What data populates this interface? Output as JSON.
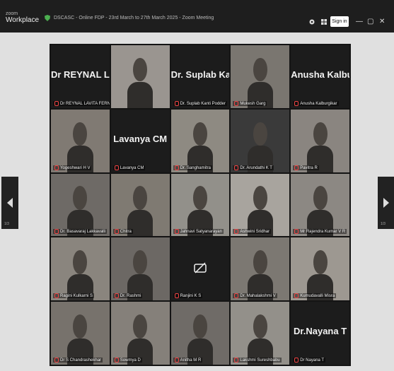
{
  "app": {
    "brand_top": "zoom",
    "brand_bottom": "Workplace"
  },
  "meeting_title": "DSCASC - Online FDP - 23rd March to 27th March 2025 - Zoom Meeting",
  "signin_label": "Sign in",
  "window_controls": {
    "minimize": "—",
    "maximize": "▢",
    "close": "✕"
  },
  "page_indicator": "1/3",
  "participants": [
    {
      "name": "Dr REYNAL LAV...",
      "label": "Dr REYNAL LAVITA FERNAN...",
      "type": "name"
    },
    {
      "label": "",
      "type": "video",
      "tone": "#9a9590"
    },
    {
      "name": "Dr. Suplab Kant...",
      "label": "Dr. Suplab Kanti Podder",
      "type": "name"
    },
    {
      "label": "Mukesh Garg",
      "type": "video",
      "tone": "#7a7670"
    },
    {
      "name": "Anusha Kalburg...",
      "label": "Anusha Kalburgikar",
      "type": "name"
    },
    {
      "label": "Yogeshwari H V",
      "type": "video",
      "tone": "#807a73"
    },
    {
      "name": "Lavanya CM",
      "label": "Lavanya CM",
      "type": "name"
    },
    {
      "label": "Dr. Sanghamitra",
      "type": "video",
      "tone": "#8e8a82"
    },
    {
      "label": "Dr. Arundathi K T",
      "type": "video",
      "tone": "#3a3a3a"
    },
    {
      "label": "Pavitra R",
      "type": "video",
      "tone": "#8a8580"
    },
    {
      "label": "Dr. Basavaraj Lakkavalli",
      "type": "video",
      "tone": "#6e6a66"
    },
    {
      "label": "Chitra",
      "type": "video",
      "tone": "#7f7a72"
    },
    {
      "label": "Jahnavi Satyanarayan",
      "type": "video",
      "tone": "#92908a"
    },
    {
      "label": "Ashwini Sridhar",
      "type": "video",
      "tone": "#a8a49e"
    },
    {
      "label": "Mr Rajendra Kumar V R",
      "type": "video",
      "tone": "#8c8883"
    },
    {
      "label": "Ragini Kulkarni S",
      "type": "video",
      "tone": "#8a857e"
    },
    {
      "label": "Dr. Rashmi",
      "type": "video",
      "tone": "#6c6864"
    },
    {
      "label": "Ranjini K S",
      "type": "camoff"
    },
    {
      "label": "Dr. Mahalakshmi V",
      "type": "video",
      "tone": "#7c7872"
    },
    {
      "label": "Kumudavalli Misra",
      "type": "video",
      "tone": "#9d9891"
    },
    {
      "label": "Dr S Chandrashekhar",
      "type": "video",
      "tone": "#77726c"
    },
    {
      "label": "Sowmya D",
      "type": "video",
      "tone": "#85807a"
    },
    {
      "label": "Anitha M R",
      "type": "video",
      "tone": "#6f6b67"
    },
    {
      "label": "Lakshmi Sureshbabu",
      "type": "video",
      "tone": "#93908a"
    },
    {
      "name": "Dr.Nayana T",
      "label": "Dr Nayana T",
      "type": "name"
    }
  ]
}
